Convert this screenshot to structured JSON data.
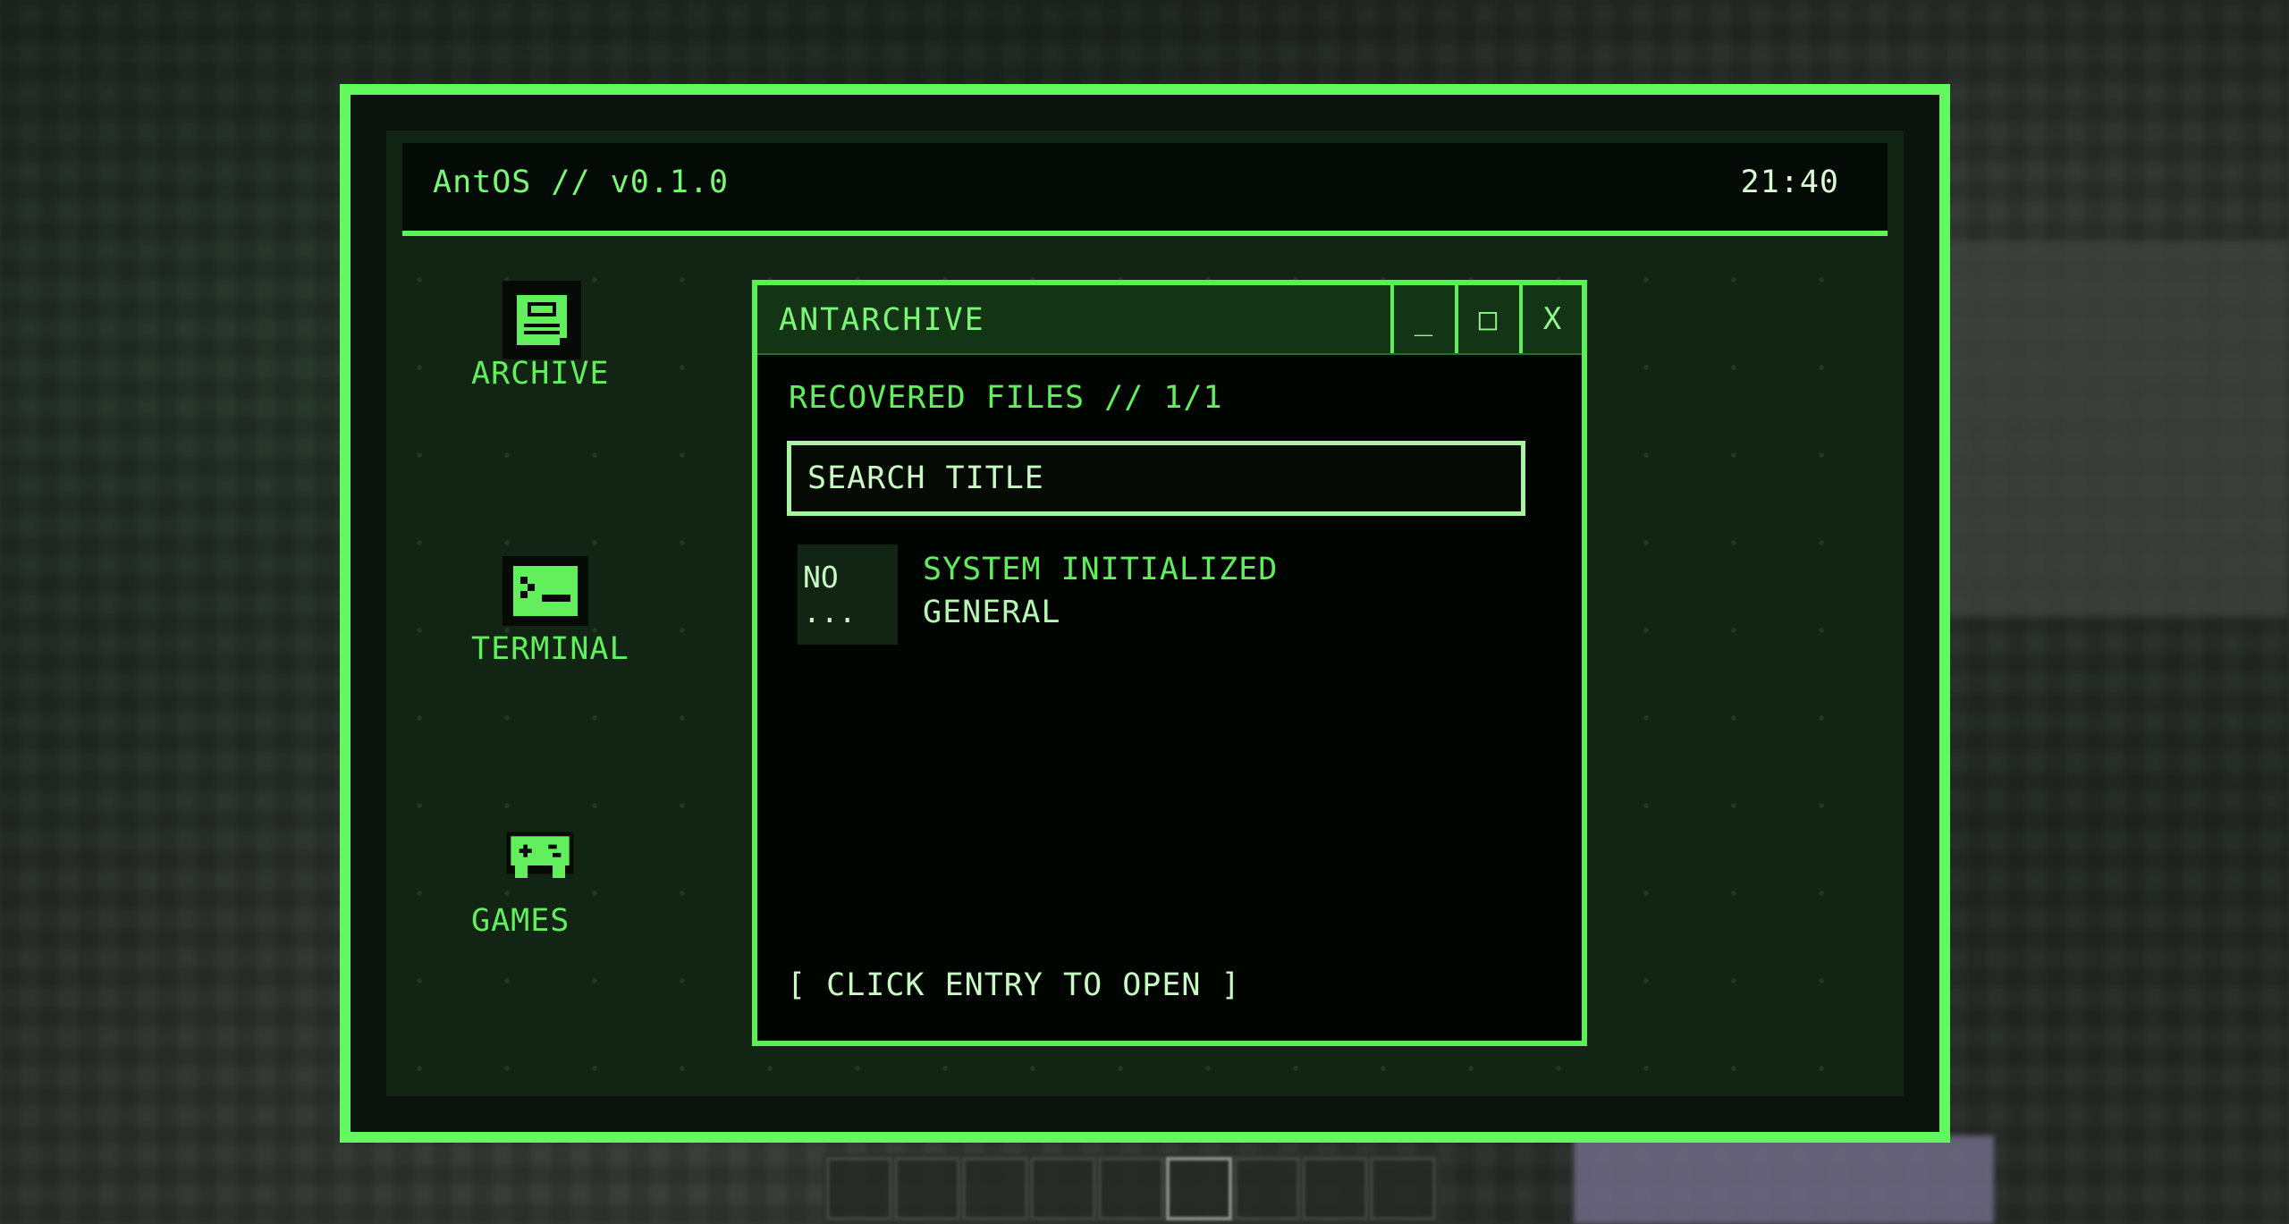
{
  "os": {
    "title": "AntOS // v0.1.0",
    "clock": "21:40"
  },
  "desktop": {
    "icons": [
      {
        "label": "ARCHIVE",
        "icon": "archive-icon"
      },
      {
        "label": "TERMINAL",
        "icon": "terminal-icon"
      },
      {
        "label": "GAMES",
        "icon": "gamepad-icon"
      }
    ]
  },
  "window": {
    "title": "ANTARCHIVE",
    "buttons": {
      "minimize": "_",
      "maximize": "□",
      "close": "X"
    },
    "section_header": "RECOVERED FILES // 1/1",
    "search": {
      "placeholder": "SEARCH TITLE",
      "value": ""
    },
    "entries": [
      {
        "thumbnail": "NO ...",
        "title": "SYSTEM INITIALIZED",
        "category": "GENERAL"
      }
    ],
    "hint": "[ CLICK ENTRY TO OPEN ]"
  },
  "colors": {
    "accent": "#64f85f",
    "screen_bg": "#122414",
    "window_bg": "#010501",
    "text_light": "#c9f8c5"
  }
}
